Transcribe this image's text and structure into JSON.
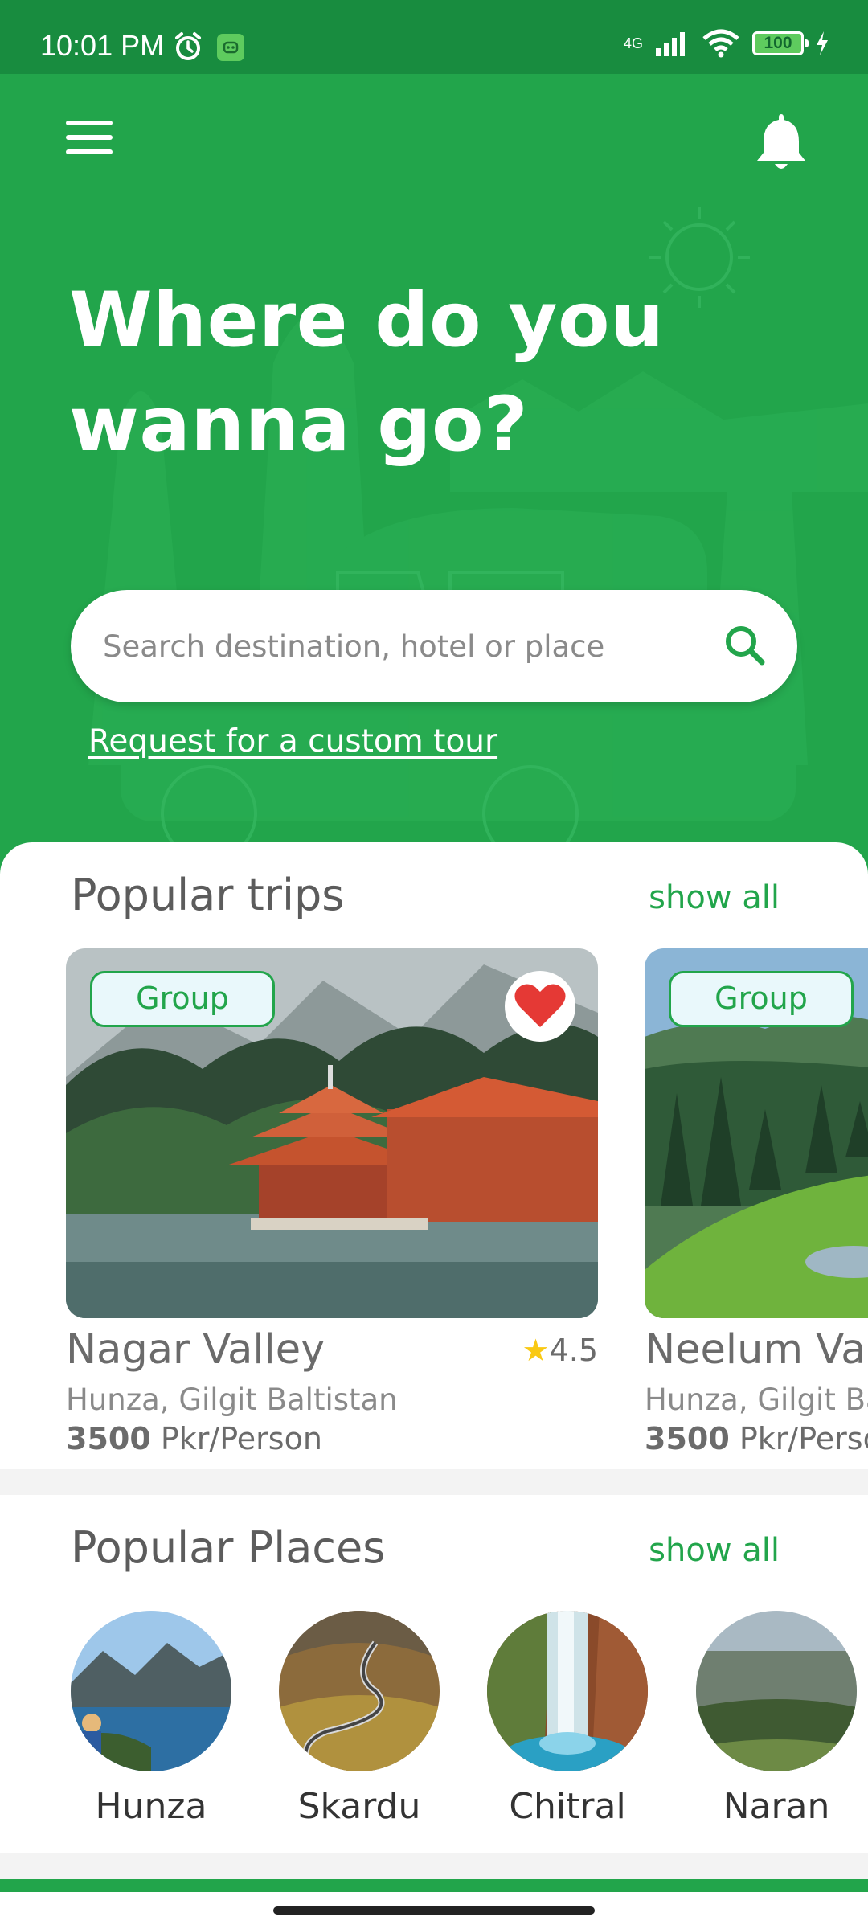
{
  "status_bar": {
    "time": "10:01 PM",
    "network": "4G",
    "battery": "100"
  },
  "header": {
    "title": "Where do you wanna go?",
    "menu_icon": "hamburger-menu-icon",
    "bell_icon": "bell-icon"
  },
  "search": {
    "placeholder": "Search destination, hotel or place",
    "icon": "search-icon"
  },
  "custom_tour_link": "Request for a custom tour",
  "popular_trips": {
    "title": "Popular trips",
    "show_all": "show all",
    "trips": [
      {
        "tag": "Group",
        "name": "Nagar Valley",
        "rating": "4.5",
        "location": "Hunza, Gilgit Baltistan",
        "price_amount": "3500",
        "price_unit": "Pkr/Person",
        "favorite": true
      },
      {
        "tag": "Group",
        "name": "Neelum Val",
        "location": "Hunza, Gilgit Ba",
        "price_amount": "3500",
        "price_unit": "Pkr/Perso"
      }
    ]
  },
  "popular_places": {
    "title": "Popular Places",
    "show_all": "show all",
    "places": [
      {
        "name": "Hunza"
      },
      {
        "name": "Skardu"
      },
      {
        "name": "Chitral"
      },
      {
        "name": "Naran"
      }
    ]
  },
  "colors": {
    "primary": "#22a54b",
    "status_bar": "#188c3f",
    "favorite": "#e53935",
    "star": "#f9c914"
  }
}
